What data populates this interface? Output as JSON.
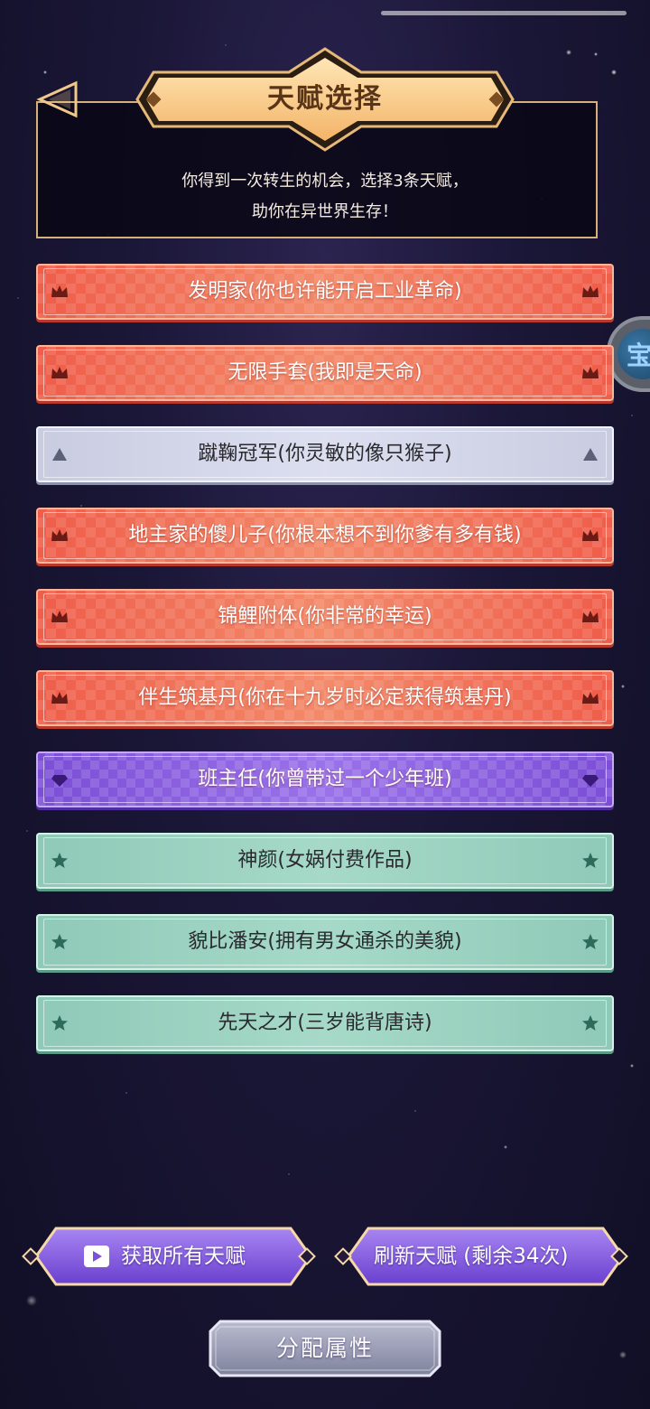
{
  "header": {
    "title": "天赋选择",
    "intro_line1": "你得到一次转生的机会，选择3条天赋，",
    "intro_line2": "助你在异世界生存！"
  },
  "talents": [
    {
      "label": "发明家(你也许能开启工业革命)",
      "rarity": "red",
      "icon": "crown-icon"
    },
    {
      "label": "无限手套(我即是天命)",
      "rarity": "red",
      "icon": "crown-icon"
    },
    {
      "label": "蹴鞠冠军(你灵敏的像只猴子)",
      "rarity": "gray",
      "icon": "triangle-icon"
    },
    {
      "label": "地主家的傻儿子(你根本想不到你爹有多有钱)",
      "rarity": "red",
      "icon": "crown-icon"
    },
    {
      "label": "锦鲤附体(你非常的幸运)",
      "rarity": "red",
      "icon": "crown-icon"
    },
    {
      "label": "伴生筑基丹(你在十九岁时必定获得筑基丹)",
      "rarity": "red",
      "icon": "crown-icon"
    },
    {
      "label": "班主任(你曾带过一个少年班)",
      "rarity": "purple",
      "icon": "gem-icon"
    },
    {
      "label": "神颜(女娲付费作品)",
      "rarity": "green",
      "icon": "star-icon"
    },
    {
      "label": "貌比潘安(拥有男女通杀的美貌)",
      "rarity": "green",
      "icon": "star-icon"
    },
    {
      "label": "先天之才(三岁能背唐诗)",
      "rarity": "green",
      "icon": "star-icon"
    }
  ],
  "side_widget": {
    "glyph": "宝"
  },
  "buttons": {
    "get_all": "获取所有天赋",
    "refresh": "刷新天赋 (剩余34次)",
    "allocate": "分配属性"
  },
  "colors": {
    "red": "#ef5d4a",
    "gray": "#d2d5e8",
    "purple": "#8a5fe0",
    "green": "#9bd0bf",
    "gold": "#f6c27a"
  }
}
